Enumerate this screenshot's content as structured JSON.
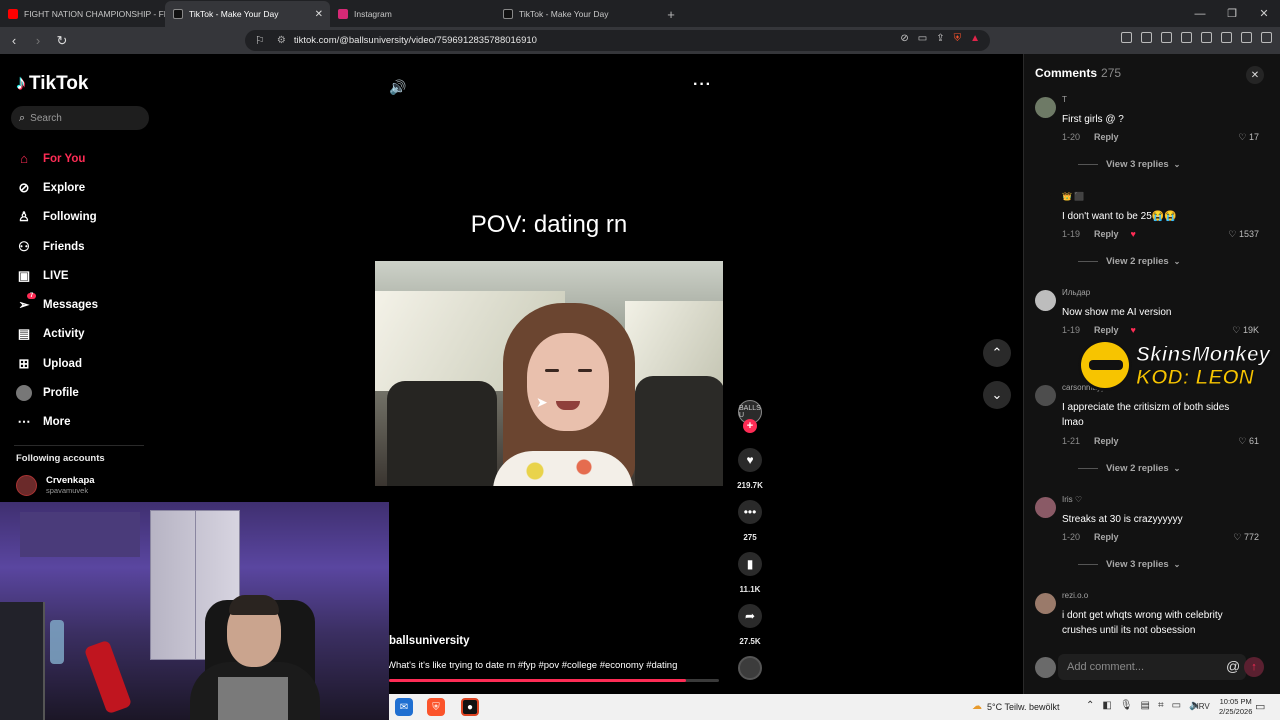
{
  "browser": {
    "tabs": [
      {
        "title": "FIGHT NATION CHAMPIONSHIP - FN",
        "favicon_color": "#ff0000",
        "active": false
      },
      {
        "title": "TikTok - Make Your Day",
        "favicon_color": "#111111",
        "active": true
      },
      {
        "title": "Instagram",
        "favicon_color": "#d62976",
        "active": false
      },
      {
        "title": "TikTok - Make Your Day",
        "favicon_color": "#111111",
        "active": false
      }
    ],
    "url": "tiktok.com/@ballsuniversity/video/7596912835788016910"
  },
  "sidebar": {
    "logo": "TikTok",
    "search_placeholder": "Search",
    "nav": [
      {
        "label": "For You",
        "icon": "home-icon",
        "active": true
      },
      {
        "label": "Explore",
        "icon": "compass-icon",
        "active": false
      },
      {
        "label": "Following",
        "icon": "following-icon",
        "active": false
      },
      {
        "label": "Friends",
        "icon": "friends-icon",
        "active": false
      },
      {
        "label": "LIVE",
        "icon": "live-icon",
        "active": false
      },
      {
        "label": "Messages",
        "icon": "messages-icon",
        "active": false,
        "badge": "7"
      },
      {
        "label": "Activity",
        "icon": "activity-icon",
        "active": false
      },
      {
        "label": "Upload",
        "icon": "upload-icon",
        "active": false
      },
      {
        "label": "Profile",
        "icon": "profile-avatar",
        "active": false
      },
      {
        "label": "More",
        "icon": "more-icon",
        "active": false
      }
    ],
    "following_title": "Following accounts",
    "following": [
      {
        "name": "Crvenkapa",
        "username": "spavamuvek"
      }
    ]
  },
  "video": {
    "caption_overlay": "POV: dating rn",
    "author": "ballsuniversity",
    "description": "What's it's like trying to date rn #fyp #pov #college #economy #dating",
    "progress": 0.9,
    "likes": "219.7K",
    "comments": "275",
    "saves": "11.1K",
    "shares": "27.5K",
    "avatar_text": "BALLS U"
  },
  "comments_panel": {
    "title": "Comments",
    "count": "275",
    "items": [
      {
        "user": "T",
        "text": "First girls @ ?",
        "date": "1-20",
        "reply": "Reply",
        "likes": "17",
        "view_replies": "View 3 replies",
        "creator_liked": false
      },
      {
        "user": "👑 ⬛",
        "text": "I don't want to be 25😭😭",
        "date": "1-19",
        "reply": "Reply",
        "likes": "1537",
        "view_replies": "View 2 replies",
        "creator_liked": true
      },
      {
        "user": "Ильдар",
        "text": "Now show me AI version",
        "date": "1-19",
        "reply": "Reply",
        "likes": "19K",
        "view_replies": "",
        "creator_liked": true
      },
      {
        "user": "carsonmayyo",
        "text": "I appreciate the critisizm of both sides lmao",
        "date": "1-21",
        "reply": "Reply",
        "likes": "61",
        "view_replies": "View 2 replies",
        "creator_liked": false
      },
      {
        "user": "Iris ♡",
        "text": "Streaks at 30 is crazyyyyyy",
        "date": "1-20",
        "reply": "Reply",
        "likes": "772",
        "view_replies": "View 3 replies",
        "creator_liked": false
      },
      {
        "user": "rezi.o.o",
        "text": "i dont get whqts wrong with celebrity crushes until its not obsession",
        "date": "",
        "reply": "",
        "likes": "",
        "view_replies": "",
        "creator_liked": false
      }
    ],
    "input_placeholder": "Add comment..."
  },
  "sponsor": {
    "line1": "SkinsMonkey",
    "line2": "KOD: LEON"
  },
  "taskbar": {
    "weather": "5°C  Teilw. bewölkt",
    "lang": "HRV",
    "time": "10:05 PM",
    "date": "2/25/2026"
  }
}
